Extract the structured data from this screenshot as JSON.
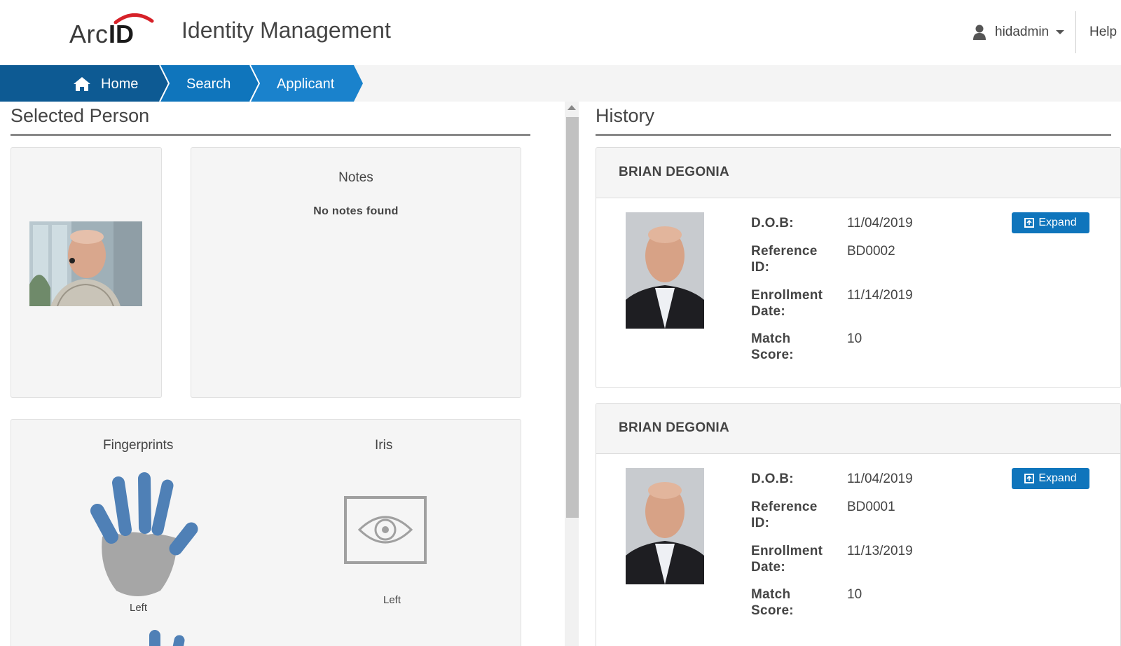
{
  "header": {
    "logo_arc": "Arc",
    "logo_id": "ID",
    "app_title": "Identity Management",
    "username": "hidadmin",
    "help_label": "Help"
  },
  "breadcrumb": {
    "items": [
      {
        "label": "Home",
        "icon": "home-icon"
      },
      {
        "label": "Search"
      },
      {
        "label": "Applicant"
      }
    ],
    "accent": "#0f75bc"
  },
  "selected_person": {
    "title": "Selected Person",
    "notes_title": "Notes",
    "notes_empty": "No notes found",
    "biometrics": {
      "fingerprints_title": "Fingerprints",
      "fingerprints_side": "Left",
      "iris_title": "Iris",
      "iris_side": "Left"
    }
  },
  "history": {
    "title": "History",
    "records": [
      {
        "name": "BRIAN DEGONIA",
        "dob_label": "D.O.B:",
        "dob": "11/04/2019",
        "ref_label_1": "Reference",
        "ref_label_2": "ID:",
        "reference_id": "BD0002",
        "enroll_label_1": "Enrollment",
        "enroll_label_2": "Date:",
        "enrollment_date": "11/14/2019",
        "score_label_1": "Match",
        "score_label_2": "Score:",
        "match_score": "10",
        "expand_label": "Expand"
      },
      {
        "name": "BRIAN DEGONIA",
        "dob_label": "D.O.B:",
        "dob": "11/04/2019",
        "ref_label_1": "Reference",
        "ref_label_2": "ID:",
        "reference_id": "BD0001",
        "enroll_label_1": "Enrollment",
        "enroll_label_2": "Date:",
        "enrollment_date": "11/13/2019",
        "score_label_1": "Match",
        "score_label_2": "Score:",
        "match_score": "10",
        "expand_label": "Expand"
      }
    ]
  },
  "colors": {
    "primary": "#0f75bc",
    "primary_dark": "#0d5a93",
    "finger_blue": "#4f80b6",
    "palm_gray": "#a6a6a6"
  }
}
